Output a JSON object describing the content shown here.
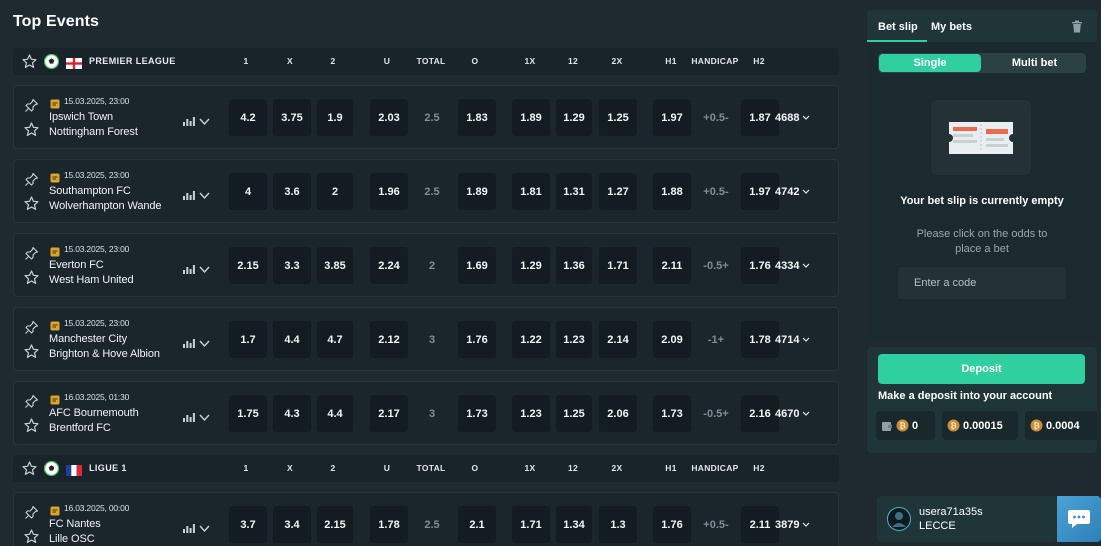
{
  "page_title": "Top Events",
  "columns": [
    "1",
    "X",
    "2",
    "U",
    "TOTAL",
    "O",
    "1X",
    "12",
    "2X",
    "H1",
    "HANDICAP",
    "H2"
  ],
  "leagues": [
    {
      "name": "PREMIER LEAGUE",
      "flag": "england-flag",
      "matches": [
        {
          "datetime": "15.03.2025, 23:00",
          "home": "Ipswich Town",
          "away": "Nottingham Forest",
          "odds": {
            "o1": "4.2",
            "x": "3.75",
            "o2": "1.9",
            "u": "2.03",
            "total": "2.5",
            "o": "1.83",
            "o1x": "1.89",
            "o12": "1.29",
            "o2x": "1.25",
            "h1": "1.97",
            "handicap": "+0.5-",
            "h2": "1.87"
          },
          "more": "4688"
        },
        {
          "datetime": "15.03.2025, 23:00",
          "home": "Southampton FC",
          "away": "Wolverhampton Wande",
          "odds": {
            "o1": "4",
            "x": "3.6",
            "o2": "2",
            "u": "1.96",
            "total": "2.5",
            "o": "1.89",
            "o1x": "1.81",
            "o12": "1.31",
            "o2x": "1.27",
            "h1": "1.88",
            "handicap": "+0.5-",
            "h2": "1.97"
          },
          "more": "4742"
        },
        {
          "datetime": "15.03.2025, 23:00",
          "home": "Everton FC",
          "away": "West Ham United",
          "odds": {
            "o1": "2.15",
            "x": "3.3",
            "o2": "3.85",
            "u": "2.24",
            "total": "2",
            "o": "1.69",
            "o1x": "1.29",
            "o12": "1.36",
            "o2x": "1.71",
            "h1": "2.11",
            "handicap": "-0.5+",
            "h2": "1.76"
          },
          "more": "4334"
        },
        {
          "datetime": "15.03.2025, 23:00",
          "home": "Manchester City",
          "away": "Brighton & Hove Albion",
          "odds": {
            "o1": "1.7",
            "x": "4.4",
            "o2": "4.7",
            "u": "2.12",
            "total": "3",
            "o": "1.76",
            "o1x": "1.22",
            "o12": "1.23",
            "o2x": "2.14",
            "h1": "2.09",
            "handicap": "-1+",
            "h2": "1.78"
          },
          "more": "4714"
        },
        {
          "datetime": "16.03.2025, 01:30",
          "home": "AFC Bournemouth",
          "away": "Brentford FC",
          "odds": {
            "o1": "1.75",
            "x": "4.3",
            "o2": "4.4",
            "u": "2.17",
            "total": "3",
            "o": "1.73",
            "o1x": "1.23",
            "o12": "1.25",
            "o2x": "2.06",
            "h1": "1.73",
            "handicap": "-0.5+",
            "h2": "2.16"
          },
          "more": "4670"
        }
      ]
    },
    {
      "name": "LIGUE 1",
      "flag": "france-flag",
      "matches": [
        {
          "datetime": "16.03.2025, 00:00",
          "home": "FC Nantes",
          "away": "Lille OSC",
          "odds": {
            "o1": "3.7",
            "x": "3.4",
            "o2": "2.15",
            "u": "1.78",
            "total": "2.5",
            "o": "2.1",
            "o1x": "1.71",
            "o12": "1.34",
            "o2x": "1.3",
            "h1": "1.76",
            "handicap": "+0.5-",
            "h2": "2.11"
          },
          "more": "3879"
        }
      ]
    }
  ],
  "sidebar": {
    "tab_betslip": "Bet slip",
    "tab_mybets": "My bets",
    "mode_single": "Single",
    "mode_multi": "Multi bet",
    "empty_title": "Your bet slip is currently empty",
    "empty_hint": "Please click on the odds to place a bet",
    "code_placeholder": "Enter a code",
    "deposit_label": "Deposit",
    "deposit_text": "Make a deposit into your account",
    "balances": [
      "0",
      "0.00015",
      "0.0004"
    ],
    "user_name": "usera71a35s",
    "user_team": "LECCE"
  },
  "colors": {
    "accent": "#2fcf9f",
    "background": "#1e2a30",
    "row": "#1b262c",
    "odd_cell": "#131c21"
  }
}
